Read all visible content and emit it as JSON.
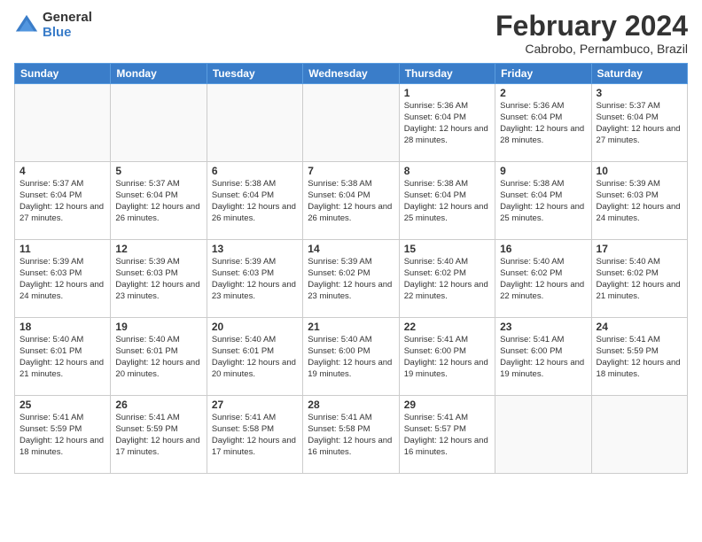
{
  "logo": {
    "general": "General",
    "blue": "Blue"
  },
  "title": "February 2024",
  "subtitle": "Cabrobo, Pernambuco, Brazil",
  "days_header": [
    "Sunday",
    "Monday",
    "Tuesday",
    "Wednesday",
    "Thursday",
    "Friday",
    "Saturday"
  ],
  "weeks": [
    [
      {
        "num": "",
        "info": ""
      },
      {
        "num": "",
        "info": ""
      },
      {
        "num": "",
        "info": ""
      },
      {
        "num": "",
        "info": ""
      },
      {
        "num": "1",
        "info": "Sunrise: 5:36 AM\nSunset: 6:04 PM\nDaylight: 12 hours\nand 28 minutes."
      },
      {
        "num": "2",
        "info": "Sunrise: 5:36 AM\nSunset: 6:04 PM\nDaylight: 12 hours\nand 28 minutes."
      },
      {
        "num": "3",
        "info": "Sunrise: 5:37 AM\nSunset: 6:04 PM\nDaylight: 12 hours\nand 27 minutes."
      }
    ],
    [
      {
        "num": "4",
        "info": "Sunrise: 5:37 AM\nSunset: 6:04 PM\nDaylight: 12 hours\nand 27 minutes."
      },
      {
        "num": "5",
        "info": "Sunrise: 5:37 AM\nSunset: 6:04 PM\nDaylight: 12 hours\nand 26 minutes."
      },
      {
        "num": "6",
        "info": "Sunrise: 5:38 AM\nSunset: 6:04 PM\nDaylight: 12 hours\nand 26 minutes."
      },
      {
        "num": "7",
        "info": "Sunrise: 5:38 AM\nSunset: 6:04 PM\nDaylight: 12 hours\nand 26 minutes."
      },
      {
        "num": "8",
        "info": "Sunrise: 5:38 AM\nSunset: 6:04 PM\nDaylight: 12 hours\nand 25 minutes."
      },
      {
        "num": "9",
        "info": "Sunrise: 5:38 AM\nSunset: 6:04 PM\nDaylight: 12 hours\nand 25 minutes."
      },
      {
        "num": "10",
        "info": "Sunrise: 5:39 AM\nSunset: 6:03 PM\nDaylight: 12 hours\nand 24 minutes."
      }
    ],
    [
      {
        "num": "11",
        "info": "Sunrise: 5:39 AM\nSunset: 6:03 PM\nDaylight: 12 hours\nand 24 minutes."
      },
      {
        "num": "12",
        "info": "Sunrise: 5:39 AM\nSunset: 6:03 PM\nDaylight: 12 hours\nand 23 minutes."
      },
      {
        "num": "13",
        "info": "Sunrise: 5:39 AM\nSunset: 6:03 PM\nDaylight: 12 hours\nand 23 minutes."
      },
      {
        "num": "14",
        "info": "Sunrise: 5:39 AM\nSunset: 6:02 PM\nDaylight: 12 hours\nand 23 minutes."
      },
      {
        "num": "15",
        "info": "Sunrise: 5:40 AM\nSunset: 6:02 PM\nDaylight: 12 hours\nand 22 minutes."
      },
      {
        "num": "16",
        "info": "Sunrise: 5:40 AM\nSunset: 6:02 PM\nDaylight: 12 hours\nand 22 minutes."
      },
      {
        "num": "17",
        "info": "Sunrise: 5:40 AM\nSunset: 6:02 PM\nDaylight: 12 hours\nand 21 minutes."
      }
    ],
    [
      {
        "num": "18",
        "info": "Sunrise: 5:40 AM\nSunset: 6:01 PM\nDaylight: 12 hours\nand 21 minutes."
      },
      {
        "num": "19",
        "info": "Sunrise: 5:40 AM\nSunset: 6:01 PM\nDaylight: 12 hours\nand 20 minutes."
      },
      {
        "num": "20",
        "info": "Sunrise: 5:40 AM\nSunset: 6:01 PM\nDaylight: 12 hours\nand 20 minutes."
      },
      {
        "num": "21",
        "info": "Sunrise: 5:40 AM\nSunset: 6:00 PM\nDaylight: 12 hours\nand 19 minutes."
      },
      {
        "num": "22",
        "info": "Sunrise: 5:41 AM\nSunset: 6:00 PM\nDaylight: 12 hours\nand 19 minutes."
      },
      {
        "num": "23",
        "info": "Sunrise: 5:41 AM\nSunset: 6:00 PM\nDaylight: 12 hours\nand 19 minutes."
      },
      {
        "num": "24",
        "info": "Sunrise: 5:41 AM\nSunset: 5:59 PM\nDaylight: 12 hours\nand 18 minutes."
      }
    ],
    [
      {
        "num": "25",
        "info": "Sunrise: 5:41 AM\nSunset: 5:59 PM\nDaylight: 12 hours\nand 18 minutes."
      },
      {
        "num": "26",
        "info": "Sunrise: 5:41 AM\nSunset: 5:59 PM\nDaylight: 12 hours\nand 17 minutes."
      },
      {
        "num": "27",
        "info": "Sunrise: 5:41 AM\nSunset: 5:58 PM\nDaylight: 12 hours\nand 17 minutes."
      },
      {
        "num": "28",
        "info": "Sunrise: 5:41 AM\nSunset: 5:58 PM\nDaylight: 12 hours\nand 16 minutes."
      },
      {
        "num": "29",
        "info": "Sunrise: 5:41 AM\nSunset: 5:57 PM\nDaylight: 12 hours\nand 16 minutes."
      },
      {
        "num": "",
        "info": ""
      },
      {
        "num": "",
        "info": ""
      }
    ]
  ]
}
